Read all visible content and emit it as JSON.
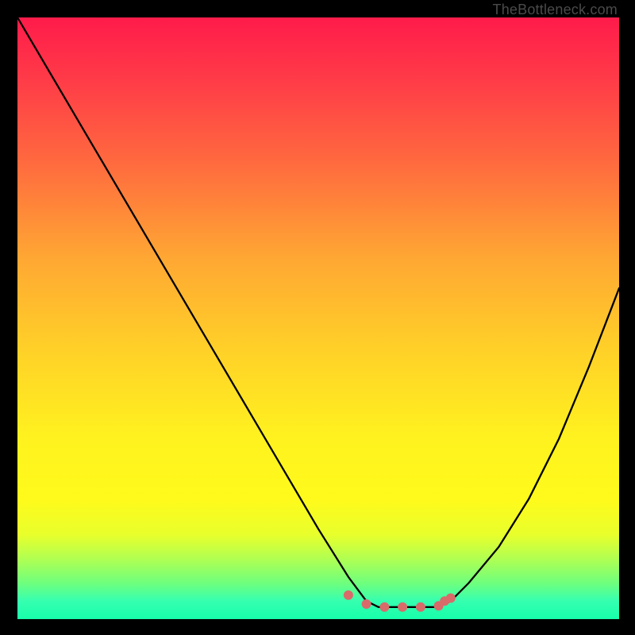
{
  "attribution": "TheBottleneck.com",
  "chart_data": {
    "type": "line",
    "title": "",
    "xlabel": "",
    "ylabel": "",
    "xlim": [
      0,
      100
    ],
    "ylim": [
      0,
      100
    ],
    "grid": false,
    "series": [
      {
        "name": "curve",
        "x": [
          0,
          10,
          20,
          30,
          40,
          50,
          55,
          58,
          60,
          65,
          70,
          72,
          75,
          80,
          85,
          90,
          95,
          100
        ],
        "y": [
          100,
          83,
          66,
          49,
          32,
          15,
          7,
          3,
          2,
          2,
          2,
          3,
          6,
          12,
          20,
          30,
          42,
          55
        ]
      },
      {
        "name": "dots",
        "type": "scatter",
        "x": [
          55,
          58,
          61,
          64,
          67,
          70,
          71,
          72
        ],
        "y": [
          4,
          2.5,
          2,
          2,
          2,
          2.2,
          3,
          3.5
        ]
      }
    ],
    "colors": {
      "curve": "#000000",
      "dots": "#d96a6a",
      "background_gradient_top": "#ff1b4a",
      "background_gradient_bottom": "#17ffaa"
    }
  }
}
